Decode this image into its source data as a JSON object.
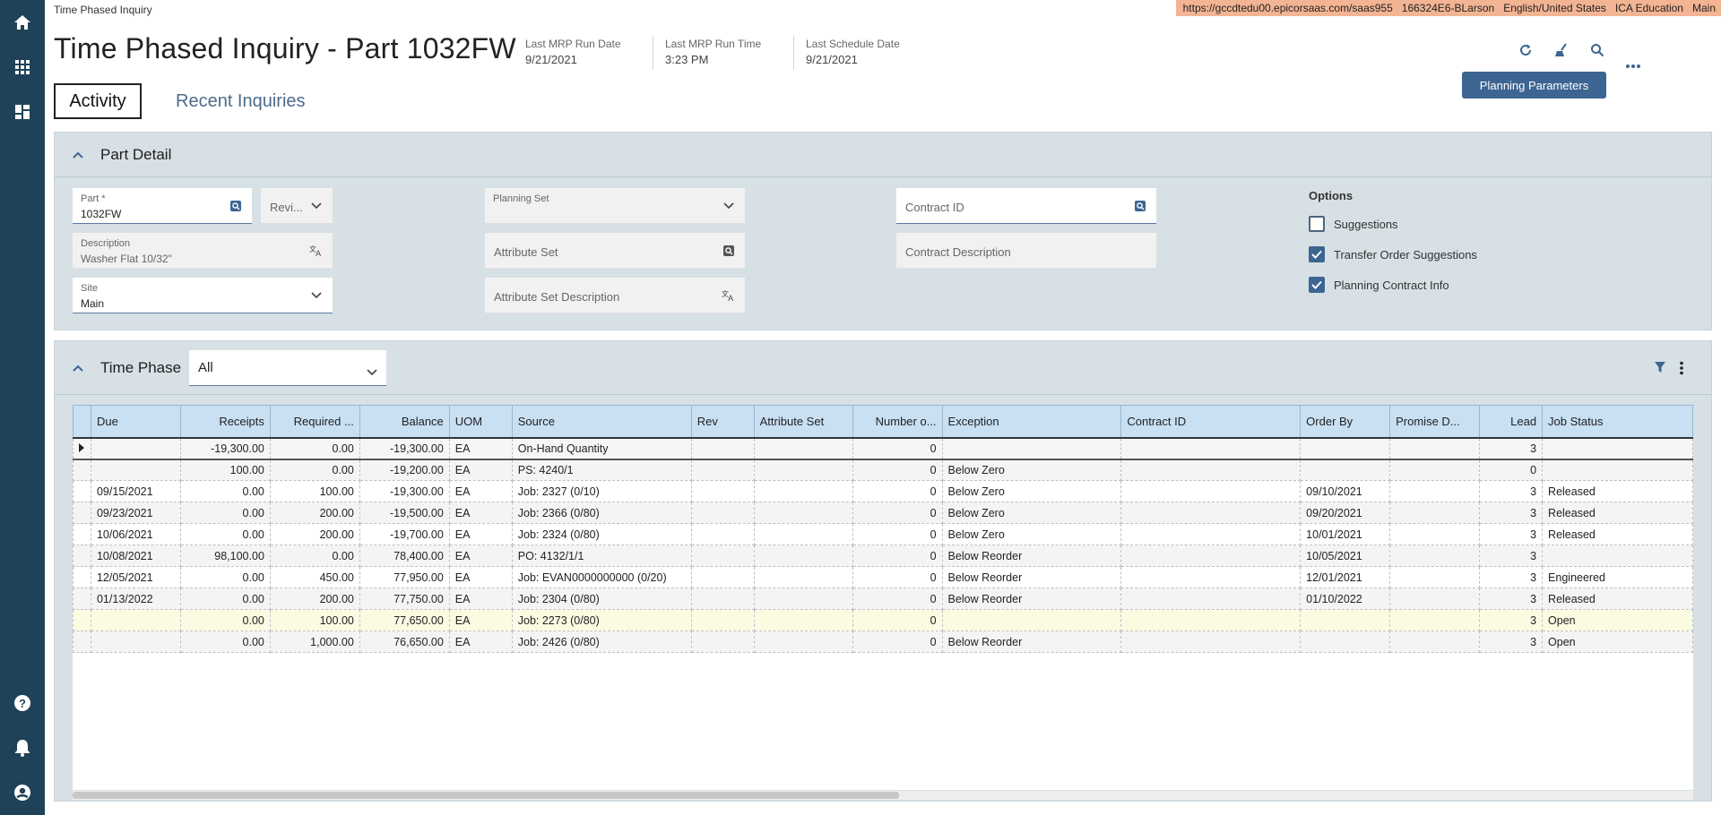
{
  "breadcrumb": "Time Phased Inquiry",
  "env": {
    "url": "https://gccdtedu00.epicorsaas.com/saas955",
    "user": "166324E6-BLarson",
    "language": "English/United States",
    "company": "ICA Education",
    "site": "Main"
  },
  "header": {
    "title": "Time Phased Inquiry - Part 1032FW",
    "meta": [
      {
        "label": "Last MRP Run Date",
        "value": "9/21/2021"
      },
      {
        "label": "Last MRP Run Time",
        "value": "3:23 PM"
      },
      {
        "label": "Last Schedule Date",
        "value": "9/21/2021"
      }
    ],
    "planning_parameters_label": "Planning Parameters"
  },
  "tabs": [
    {
      "label": "Activity",
      "active": true
    },
    {
      "label": "Recent Inquiries",
      "active": false
    }
  ],
  "part_detail": {
    "title": "Part Detail",
    "part": {
      "label": "Part *",
      "value": "1032FW"
    },
    "revision": {
      "placeholder": "Revi..."
    },
    "description": {
      "label": "Description",
      "value": "Washer Flat 10/32\""
    },
    "site": {
      "label": "Site",
      "value": "Main"
    },
    "planning_set": {
      "label": "Planning Set",
      "value": ""
    },
    "attribute_set": {
      "placeholder": "Attribute Set"
    },
    "attribute_set_description": {
      "placeholder": "Attribute Set Description"
    },
    "contract_id": {
      "placeholder": "Contract ID"
    },
    "contract_description": {
      "placeholder": "Contract Description"
    },
    "options": {
      "title": "Options",
      "items": [
        {
          "label": "Suggestions",
          "checked": false
        },
        {
          "label": "Transfer Order Suggestions",
          "checked": true
        },
        {
          "label": "Planning Contract Info",
          "checked": true
        }
      ]
    }
  },
  "time_phase": {
    "title": "Time Phase",
    "filter_value": "All",
    "columns": [
      "",
      "Due",
      "Receipts",
      "Required ...",
      "Balance",
      "UOM",
      "Source",
      "Rev",
      "Attribute Set",
      "Number o...",
      "Exception",
      "Contract ID",
      "Order By",
      "Promise D...",
      "Lead",
      "Job Status"
    ],
    "rows": [
      [
        "",
        "",
        "-19,300.00",
        "0.00",
        "-19,300.00",
        "EA",
        "On-Hand Quantity",
        "",
        "",
        "0",
        "",
        "",
        "",
        "",
        "3",
        ""
      ],
      [
        "",
        "",
        "100.00",
        "0.00",
        "-19,200.00",
        "EA",
        "PS: 4240/1",
        "",
        "",
        "0",
        "Below Zero",
        "",
        "",
        "",
        "0",
        ""
      ],
      [
        "",
        "09/15/2021",
        "0.00",
        "100.00",
        "-19,300.00",
        "EA",
        "Job: 2327 (0/10)",
        "",
        "",
        "0",
        "Below Zero",
        "",
        "09/10/2021",
        "",
        "3",
        "Released"
      ],
      [
        "",
        "09/23/2021",
        "0.00",
        "200.00",
        "-19,500.00",
        "EA",
        "Job: 2366 (0/80)",
        "",
        "",
        "0",
        "Below Zero",
        "",
        "09/20/2021",
        "",
        "3",
        "Released"
      ],
      [
        "",
        "10/06/2021",
        "0.00",
        "200.00",
        "-19,700.00",
        "EA",
        "Job: 2324 (0/80)",
        "",
        "",
        "0",
        "Below Zero",
        "",
        "10/01/2021",
        "",
        "3",
        "Released"
      ],
      [
        "",
        "10/08/2021",
        "98,100.00",
        "0.00",
        "78,400.00",
        "EA",
        "PO: 4132/1/1",
        "",
        "",
        "0",
        "Below Reorder",
        "",
        "10/05/2021",
        "",
        "3",
        ""
      ],
      [
        "",
        "12/05/2021",
        "0.00",
        "450.00",
        "77,950.00",
        "EA",
        "Job: EVAN0000000000 (0/20)",
        "",
        "",
        "0",
        "Below Reorder",
        "",
        "12/01/2021",
        "",
        "3",
        "Engineered"
      ],
      [
        "",
        "01/13/2022",
        "0.00",
        "200.00",
        "77,750.00",
        "EA",
        "Job: 2304 (0/80)",
        "",
        "",
        "0",
        "Below Reorder",
        "",
        "01/10/2022",
        "",
        "3",
        "Released"
      ],
      [
        "",
        "",
        "0.00",
        "100.00",
        "77,650.00",
        "EA",
        "Job: 2273 (0/80)",
        "",
        "",
        "0",
        "",
        "",
        "",
        "",
        "3",
        "Open"
      ],
      [
        "",
        "",
        "0.00",
        "1,000.00",
        "76,650.00",
        "EA",
        "Job: 2426 (0/80)",
        "",
        "",
        "0",
        "Below Reorder",
        "",
        "",
        "",
        "3",
        "Open"
      ]
    ]
  },
  "colors": {
    "nav": "#1f4258",
    "accent": "#3d6591",
    "header_row": "#c9e0f3",
    "env_bar": "#f3b493"
  }
}
